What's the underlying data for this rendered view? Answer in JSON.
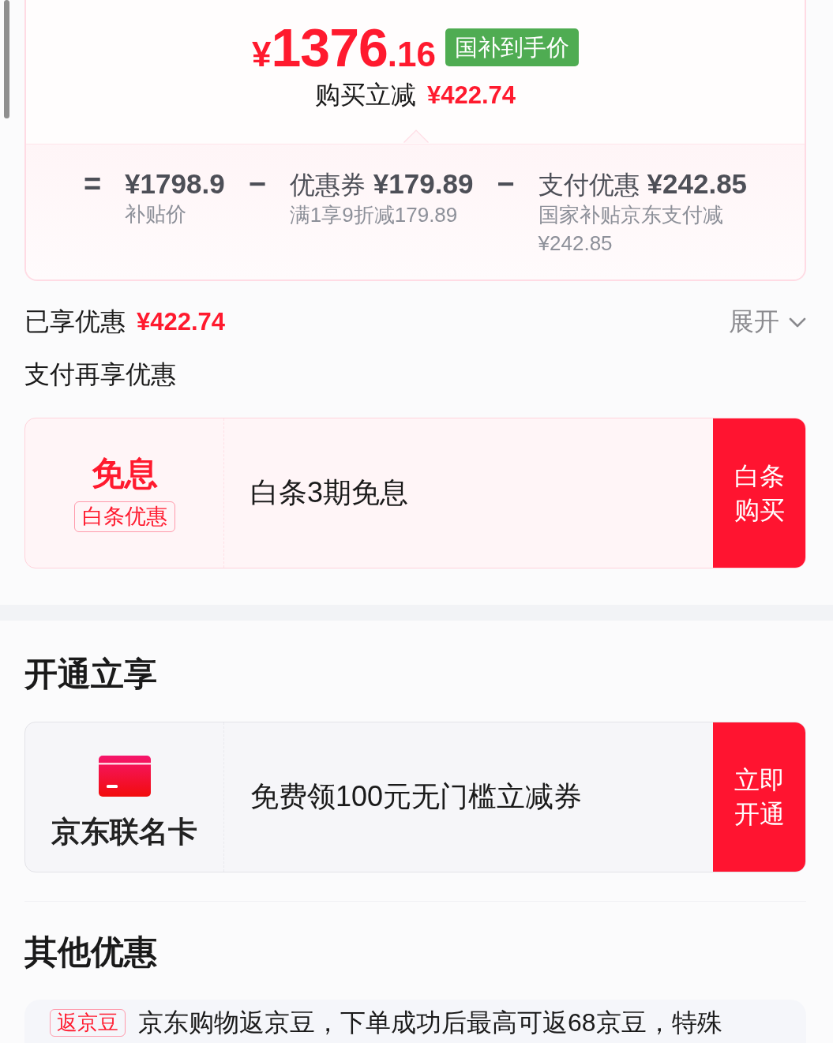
{
  "price_card": {
    "price": {
      "currency": "¥",
      "integer": "1376",
      "decimal": ".16"
    },
    "badge": "国补到手价",
    "reduction": {
      "label": "购买立减",
      "amount": "¥422.74"
    },
    "breakdown": [
      {
        "operator": "=",
        "amount": "¥1798.9",
        "note": "补贴价"
      },
      {
        "operator": "−",
        "label": "优惠券",
        "amount": "¥179.89",
        "note": "满1享9折减179.89"
      },
      {
        "operator": "−",
        "label": "支付优惠",
        "amount": "¥242.85",
        "note": "国家补贴京东支付减¥242.85"
      }
    ]
  },
  "savings": {
    "label": "已享优惠",
    "amount": "¥422.74",
    "toggle": "展开",
    "expanded": false
  },
  "pay_section": {
    "title": "支付再享优惠",
    "offer": {
      "kind": "interest_free",
      "headline": "免息",
      "tag": "白条优惠",
      "description": "白条3期免息",
      "button": "白条购买"
    }
  },
  "open_section": {
    "title": "开通立享",
    "offer": {
      "kind": "co_branded_card",
      "name": "京东联名卡",
      "description": "免费领100元无门槛立减券",
      "button": "立即开通"
    }
  },
  "other_section": {
    "title": "其他优惠",
    "items": [
      {
        "tag": "返京豆",
        "text": "京东购物返京豆，下单成功后最高可返68京豆，特殊"
      }
    ]
  }
}
